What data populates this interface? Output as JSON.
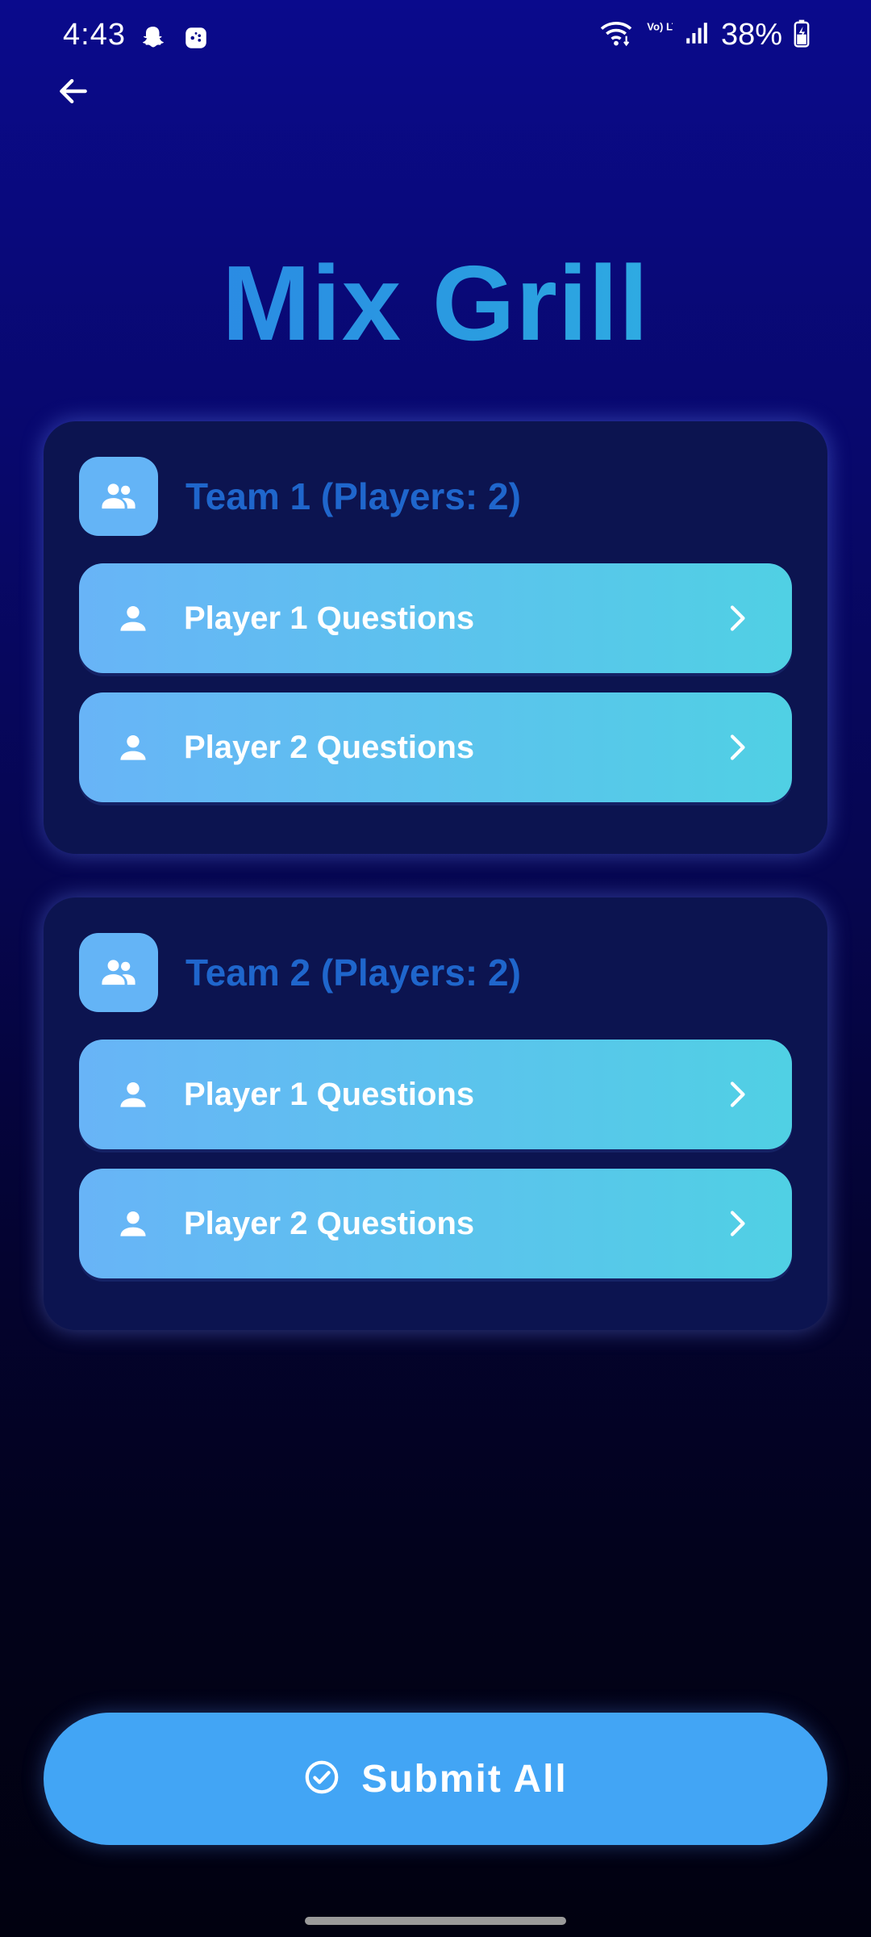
{
  "status_bar": {
    "time": "4:43",
    "left_icons": [
      "snapchat-icon",
      "game-icon"
    ],
    "right_icons": [
      "wifi-icon",
      "volte-icon",
      "signal-icon",
      "battery-icon"
    ],
    "volte_text": "Vo) LTE",
    "battery": "38%"
  },
  "header": {
    "back_icon": "arrow-left-icon",
    "title": "Mix Grill"
  },
  "teams": [
    {
      "title": "Team 1 (Players: 2)",
      "icon": "group-icon",
      "players": [
        {
          "label": "Player 1 Questions",
          "icon": "person-icon",
          "action_icon": "chevron-right-icon"
        },
        {
          "label": "Player 2 Questions",
          "icon": "person-icon",
          "action_icon": "chevron-right-icon"
        }
      ]
    },
    {
      "title": "Team 2 (Players: 2)",
      "icon": "group-icon",
      "players": [
        {
          "label": "Player 1 Questions",
          "icon": "person-icon",
          "action_icon": "chevron-right-icon"
        },
        {
          "label": "Player 2 Questions",
          "icon": "person-icon",
          "action_icon": "chevron-right-icon"
        }
      ]
    }
  ],
  "submit": {
    "label": "Submit All",
    "icon": "check-circle-icon"
  },
  "colors": {
    "background_top": "#0a0a8c",
    "background_bottom": "#010110",
    "card": "#0c1450",
    "team_title": "#1f66cc",
    "team_icon_bg": "#64b4f6",
    "player_gradient_start": "#68b4f7",
    "player_gradient_end": "#50d0e4",
    "submit_bg": "#42a5f5"
  }
}
